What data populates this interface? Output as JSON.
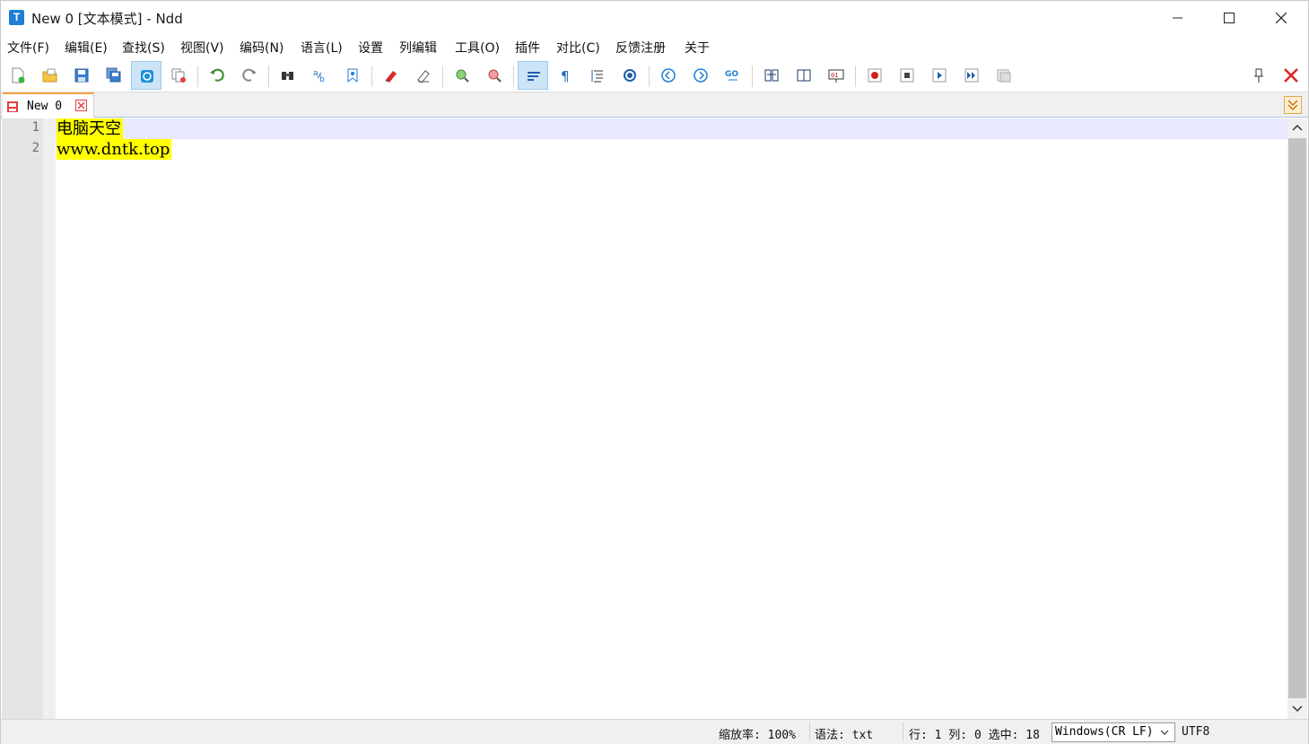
{
  "window": {
    "title": "New 0 [文本模式] - Ndd",
    "app_icon_letter": "T"
  },
  "menu": {
    "items": [
      {
        "label": "文件(F)"
      },
      {
        "label": "编辑(E)"
      },
      {
        "label": "查找(S)"
      },
      {
        "label": "视图(V)"
      },
      {
        "label": "编码(N)"
      },
      {
        "label": "语言(L)"
      },
      {
        "label": "设置"
      },
      {
        "label": "列编辑"
      },
      {
        "label": "工具(O)"
      },
      {
        "label": "插件"
      },
      {
        "label": "对比(C)"
      },
      {
        "label": "反馈注册"
      },
      {
        "label": "关于"
      }
    ]
  },
  "toolbar": {
    "icons": [
      "new-file-icon",
      "open-folder-icon",
      "save-icon",
      "save-all-icon",
      "file-monitor-icon",
      "close-all-icon",
      "undo-icon",
      "redo-icon",
      "find-icon",
      "replace-icon",
      "bookmark-icon",
      "mark-icon",
      "clear-mark-icon",
      "zoom-in-icon",
      "zoom-out-icon",
      "word-wrap-icon",
      "show-all-chars-icon",
      "indent-guide-icon",
      "highlight-icon",
      "prev-icon",
      "next-icon",
      "goto-line-icon",
      "compare-dir-icon",
      "compare-file-icon",
      "binary-view-icon",
      "macro-record-icon",
      "macro-stop-icon",
      "macro-play-icon",
      "macro-run-multiple-icon",
      "macro-save-icon",
      "pin-icon",
      "close-toolbar-icon"
    ],
    "active": [
      "file-monitor-icon",
      "word-wrap-icon"
    ]
  },
  "tabs": [
    {
      "label": "New 0",
      "active": true
    }
  ],
  "editor": {
    "lines": [
      {
        "number": "1",
        "text": "电脑天空"
      },
      {
        "number": "2",
        "text": "www.dntk.top"
      }
    ],
    "highlight_color": "#ffff00",
    "current_line_color": "#e8e8ff"
  },
  "status": {
    "zoom": "缩放率: 100%",
    "syntax": "语法: txt",
    "position": "行: 1  列: 0 选中: 18",
    "eol": "Windows(CR LF)",
    "encoding": "UTF8"
  },
  "colors": {
    "accent_tab": "#f6a33a",
    "close_red": "#e02020"
  }
}
